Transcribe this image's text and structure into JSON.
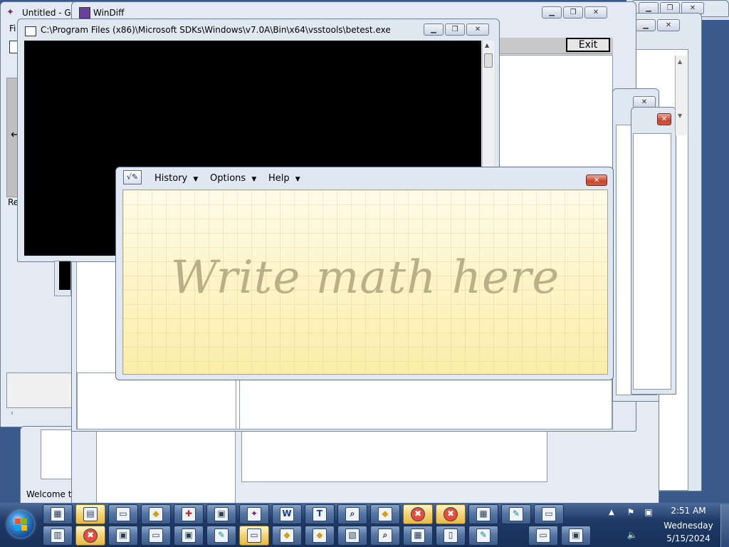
{
  "windows": {
    "graph": {
      "title": "Untitled - Gra",
      "menu_fragment": "Fi",
      "status_fragment": "Rea"
    },
    "sdd": {
      "status_text": "Welcome to Sdd"
    },
    "windiff": {
      "title": "WinDiff",
      "exit_label": "Exit"
    },
    "console": {
      "title": "C:\\Program Files (x86)\\Microsoft SDKs\\Windows\\v7.0A\\Bin\\x64\\vsstools\\betest.exe"
    }
  },
  "math_panel": {
    "menu": [
      {
        "label": "History"
      },
      {
        "label": "Options"
      },
      {
        "label": "Help"
      }
    ],
    "placeholder": "Write math here"
  },
  "taskbar": {
    "clock": {
      "time": "2:51 AM",
      "day": "Wednesday",
      "date": "5/15/2024"
    },
    "row1_icons": [
      "calculator-icon",
      "disk-icon",
      "window-icon",
      "shapes-icon",
      "tool-icon",
      "app-icon",
      "graph-icon",
      "winword-icon",
      "tb-icon",
      "search-icon",
      "shapes-icon",
      "error-icon",
      "error-icon",
      "calculator-icon",
      "pen-icon",
      "window-icon"
    ],
    "row2_icons": [
      "clipboard-icon",
      "error-icon",
      "app-icon",
      "window-icon",
      "app-icon",
      "pen-icon",
      "window-icon",
      "shapes-icon",
      "shapes-icon",
      "image-icon",
      "search-icon",
      "calculator-icon",
      "document-icon",
      "pen-icon"
    ]
  },
  "colors": {
    "taskbar": "#1f3a66",
    "active_button": "#f4d67b",
    "writing_pad": "#fdf4c8",
    "hint_text": "#b9b08a",
    "close_button": "#c6442c"
  }
}
